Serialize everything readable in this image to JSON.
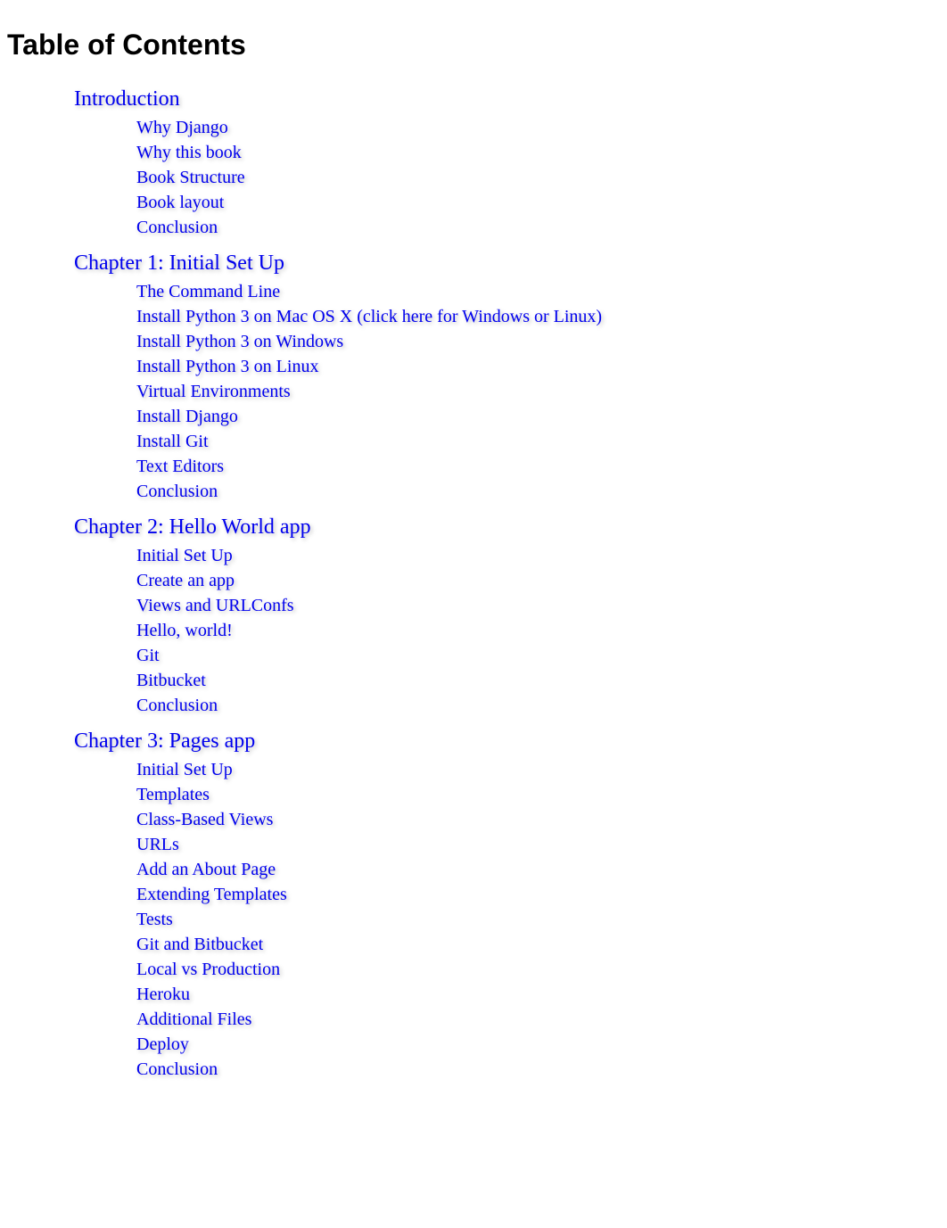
{
  "page_title": "Table of Contents",
  "chapters": [
    {
      "title": "Introduction",
      "items": [
        "Why Django",
        "Why this book",
        "Book Structure",
        "Book layout",
        "Conclusion"
      ]
    },
    {
      "title": "Chapter 1: Initial Set Up",
      "items": [
        "The Command Line",
        "Install Python 3 on Mac OS X (click here for Windows or Linux)",
        "Install Python 3 on Windows",
        "Install Python 3 on Linux",
        "Virtual Environments",
        "Install Django",
        "Install Git",
        "Text Editors",
        "Conclusion"
      ]
    },
    {
      "title": "Chapter 2: Hello World app",
      "items": [
        "Initial Set Up",
        "Create an app",
        "Views and URLConfs",
        "Hello, world!",
        "Git",
        "Bitbucket",
        "Conclusion"
      ]
    },
    {
      "title": "Chapter 3: Pages app",
      "items": [
        "Initial Set Up",
        "Templates",
        "Class-Based Views",
        "URLs",
        "Add an About Page",
        "Extending Templates",
        "Tests",
        "Git and Bitbucket",
        "Local vs Production",
        "Heroku",
        "Additional Files",
        "Deploy",
        "Conclusion"
      ]
    }
  ]
}
